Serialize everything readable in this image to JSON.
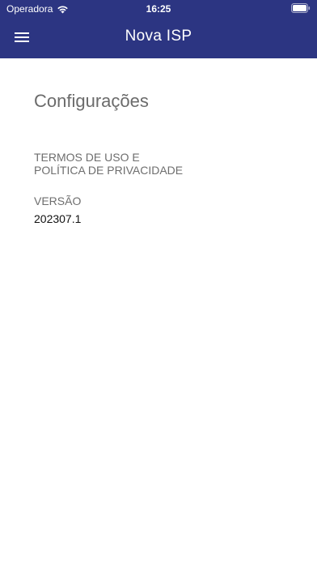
{
  "status_bar": {
    "carrier": "Operadora",
    "time": "16:25",
    "icons": [
      "wifi-icon",
      "battery-icon"
    ]
  },
  "header": {
    "title": "Nova ISP",
    "menu_icon": "hamburger-menu-icon",
    "background_color": "#2c3582"
  },
  "settings": {
    "title": "Configurações",
    "terms_line1": "TERMOS DE USO E",
    "terms_line2": "POLÍTICA DE PRIVACIDADE",
    "version_label": "VERSÃO",
    "version_value": "202307.1"
  }
}
